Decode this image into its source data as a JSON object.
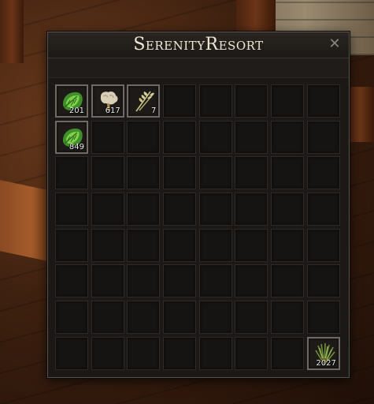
{
  "window": {
    "title": "SerenityResort",
    "close_label": "✕"
  },
  "inventory": {
    "rows": 8,
    "columns": 8,
    "items": [
      {
        "row": 0,
        "col": 0,
        "icon": "herb-leaf-icon",
        "quantity": "201"
      },
      {
        "row": 0,
        "col": 1,
        "icon": "wool-icon",
        "quantity": "617"
      },
      {
        "row": 0,
        "col": 2,
        "icon": "wheat-icon",
        "quantity": "7"
      },
      {
        "row": 1,
        "col": 0,
        "icon": "herb-leaf-icon",
        "quantity": "849"
      },
      {
        "row": 7,
        "col": 7,
        "icon": "grass-bundle-icon",
        "quantity": "2027"
      }
    ]
  }
}
